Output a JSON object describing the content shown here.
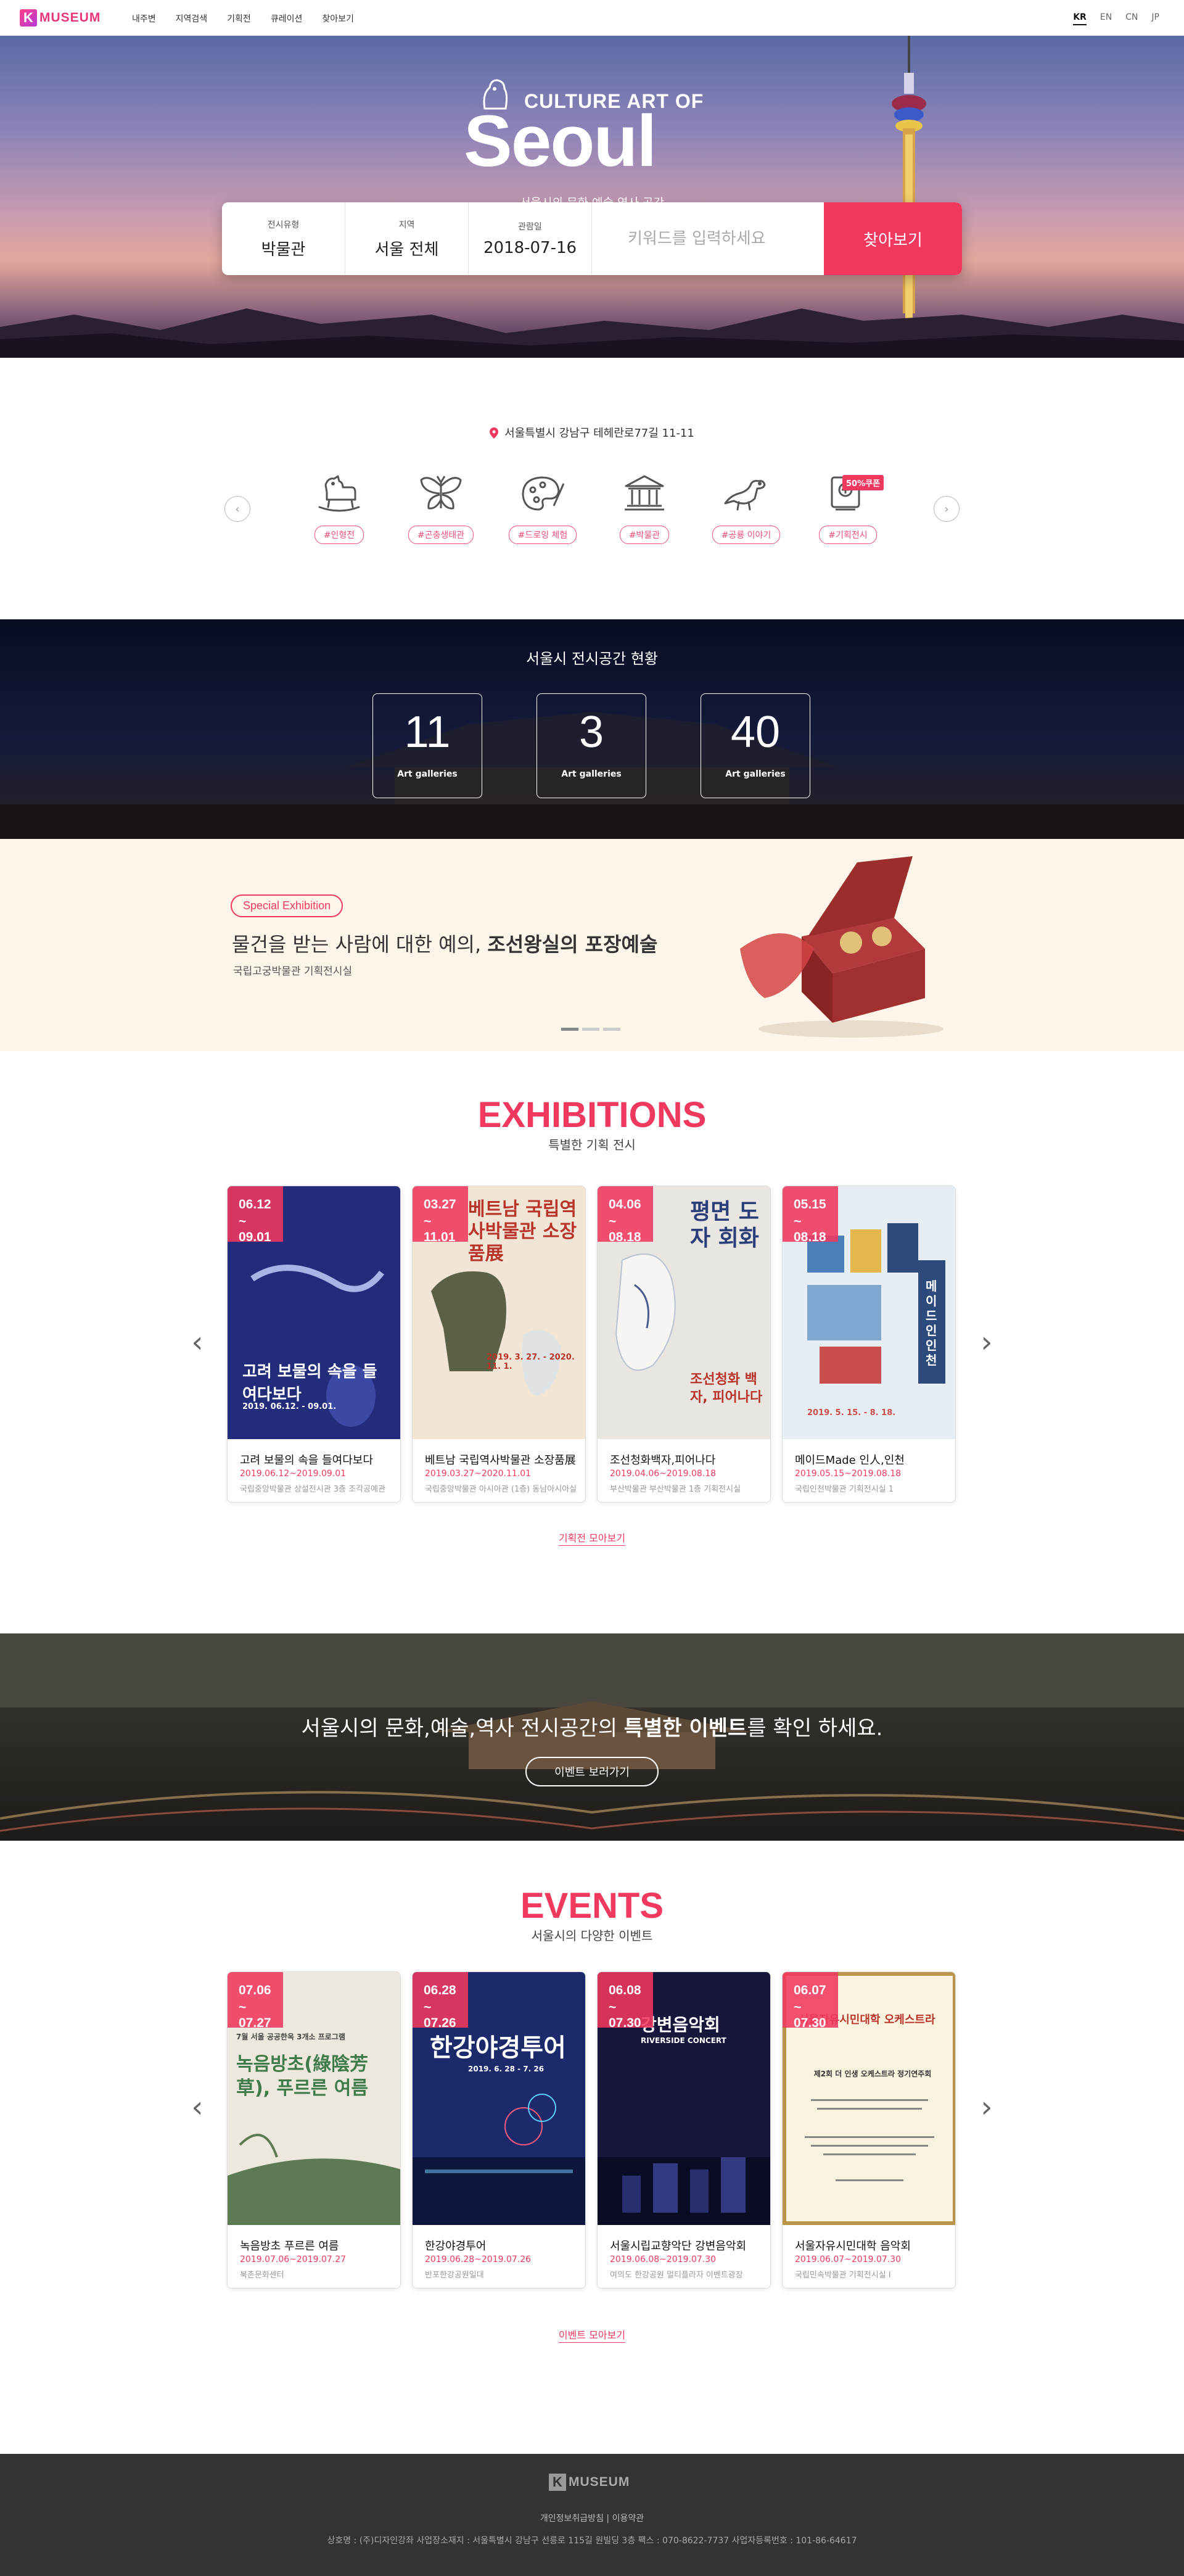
{
  "header": {
    "logo_k": "K",
    "logo_text": "MUSEUM",
    "menu": [
      "내주변",
      "지역검색",
      "기획전",
      "큐레이션",
      "찾아보기"
    ],
    "langs": [
      "KR",
      "EN",
      "CN",
      "JP"
    ]
  },
  "hero": {
    "title_small": "CULTURE ART OF",
    "title_big": "Seoul",
    "subtitle": "서울시의 문화,예술,역사 공간",
    "fields": [
      {
        "label": "전시유형",
        "value": "박물관"
      },
      {
        "label": "지역",
        "value": "서울 전체"
      },
      {
        "label": "관람일",
        "value": "2018-07-16"
      }
    ],
    "keyword_placeholder": "키워드를 입력하세요",
    "search_button": "찾아보기"
  },
  "location": {
    "address": "서울특별시 강남구 테헤란로77길 11-11"
  },
  "categories": {
    "badge": "50%쿠폰",
    "items": [
      {
        "label": "#인형전",
        "icon": "rocking-horse-icon"
      },
      {
        "label": "#곤충생태관",
        "icon": "butterfly-icon"
      },
      {
        "label": "#드로잉 체험",
        "icon": "palette-icon"
      },
      {
        "label": "#박물관",
        "icon": "museum-icon"
      },
      {
        "label": "#공룡 이야기",
        "icon": "dinosaur-icon"
      },
      {
        "label": "#기획전시",
        "icon": "exhibition-icon"
      }
    ]
  },
  "stats": {
    "title": "서울시 전시공간 현황",
    "items": [
      {
        "value": "11",
        "label": "Art galleries"
      },
      {
        "value": "3",
        "label": "Art galleries"
      },
      {
        "value": "40",
        "label": "Art galleries"
      }
    ]
  },
  "special": {
    "tag": "Special Exhibition",
    "title_plain": "물건을 받는 사람에 대한 예의, ",
    "title_bold": "조선왕실의 포장예술",
    "subtitle": "국립고궁박물관 기획전시실"
  },
  "exhibitions": {
    "title": "EXHIBITIONS",
    "subtitle": "특별한 기획 전시",
    "more": "기획전 모아보기",
    "cards": [
      {
        "date1": "06.12",
        "date2": "09.01",
        "title": "고려 보물의 속을 들여다보다",
        "dates": "2019.06.12~2019.09.01",
        "place": "국립중앙박물관 상설전시관 3층 조각공예관",
        "poster_text": "고려 보물의 속을 들여다보다",
        "poster_small": "2019. 06.12. - 09.01.",
        "color": "#232c7a"
      },
      {
        "date1": "03.27",
        "date2": "11.01",
        "title": "베트남 국립역사박물관 소장품展",
        "dates": "2019.03.27~2020.11.01",
        "place": "국립중앙박물관 아시아관 (1층) 동남아시아실",
        "poster_text": "베트남 국립역사박물관 소장품展",
        "poster_small": "2019. 3. 27. - 2020. 11. 1.",
        "color": "#f1e6d6"
      },
      {
        "date1": "04.06",
        "date2": "08.18",
        "title": "조선청화백자,피어나다",
        "dates": "2019.04.06~2019.08.18",
        "place": "부산박물관 부산박물관 1층 기획전시실",
        "poster_text": "평면 도자 회화",
        "poster_small": "조선청화 백자, 피어나다",
        "color": "#e9e6e2"
      },
      {
        "date1": "05.15",
        "date2": "08.18",
        "title": "메이드Made 인人,인천",
        "dates": "2019.05.15~2019.08.18",
        "place": "국립인천박물관 기획전시실 1",
        "poster_text": "메이드 인 인천",
        "poster_small": "2019. 5. 15. - 8. 18.",
        "color": "#e6eef4"
      }
    ]
  },
  "banner": {
    "text_plain": "서울시의 문화,예술,역사 전시공간의 ",
    "text_bold": "특별한 이벤트",
    "text_end": "를 확인 하세요.",
    "button": "이벤트 보러가기"
  },
  "events": {
    "title": "EVENTS",
    "subtitle": "서울시의 다양한 이벤트",
    "more": "이벤트 모아보기",
    "cards": [
      {
        "date1": "07.06",
        "date2": "07.27",
        "title": "녹음방초 푸르른 여름",
        "dates": "2019.07.06~2019.07.27",
        "place": "북촌문화센터",
        "poster_text": "녹음방초(綠陰芳草), 푸르른 여름",
        "poster_small": "7월 서울 공공한옥 3개소 프로그램",
        "color": "#ede8dd"
      },
      {
        "date1": "06.28",
        "date2": "07.26",
        "title": "한강야경투어",
        "dates": "2019.06.28~2019.07.26",
        "place": "반포한강공원일대",
        "poster_text": "한강야경투어",
        "poster_small": "2019. 6. 28 - 7. 26",
        "color": "#1c2a6b"
      },
      {
        "date1": "06.08",
        "date2": "07.30",
        "title": "서울시립교향악단 강변음악회",
        "dates": "2019.06.08~2019.07.30",
        "place": "여의도 한강공원 멀티플라자 이벤트광장",
        "poster_text": "강변음악회",
        "poster_small": "RIVERSIDE CONCERT",
        "color": "#15163a"
      },
      {
        "date1": "06.07",
        "date2": "07.30",
        "title": "서울자유시민대학 음악회",
        "dates": "2019.06.07~2019.07.30",
        "place": "국립민속박물관 기획전시실 Ⅰ",
        "poster_text": "서울자유시민대학 오케스트라",
        "poster_small": "제2회 더 인생 오케스트라 정기연주회",
        "color": "#faf3e0"
      }
    ]
  },
  "footer": {
    "logo_k": "K",
    "logo_text": "MUSEUM",
    "links": "개인정보취급방침  |  이용약관",
    "info": "상호명 : (주)디자인강좌   사업장소재지 : 서울특별시 강남구 선릉로 115길 원빌딩 3층  팩스 : 070-8622-7737   사업자등록번호 : 101-86-64617"
  },
  "colors": {
    "accent": "#f1385f",
    "footer_bg": "#333333"
  }
}
